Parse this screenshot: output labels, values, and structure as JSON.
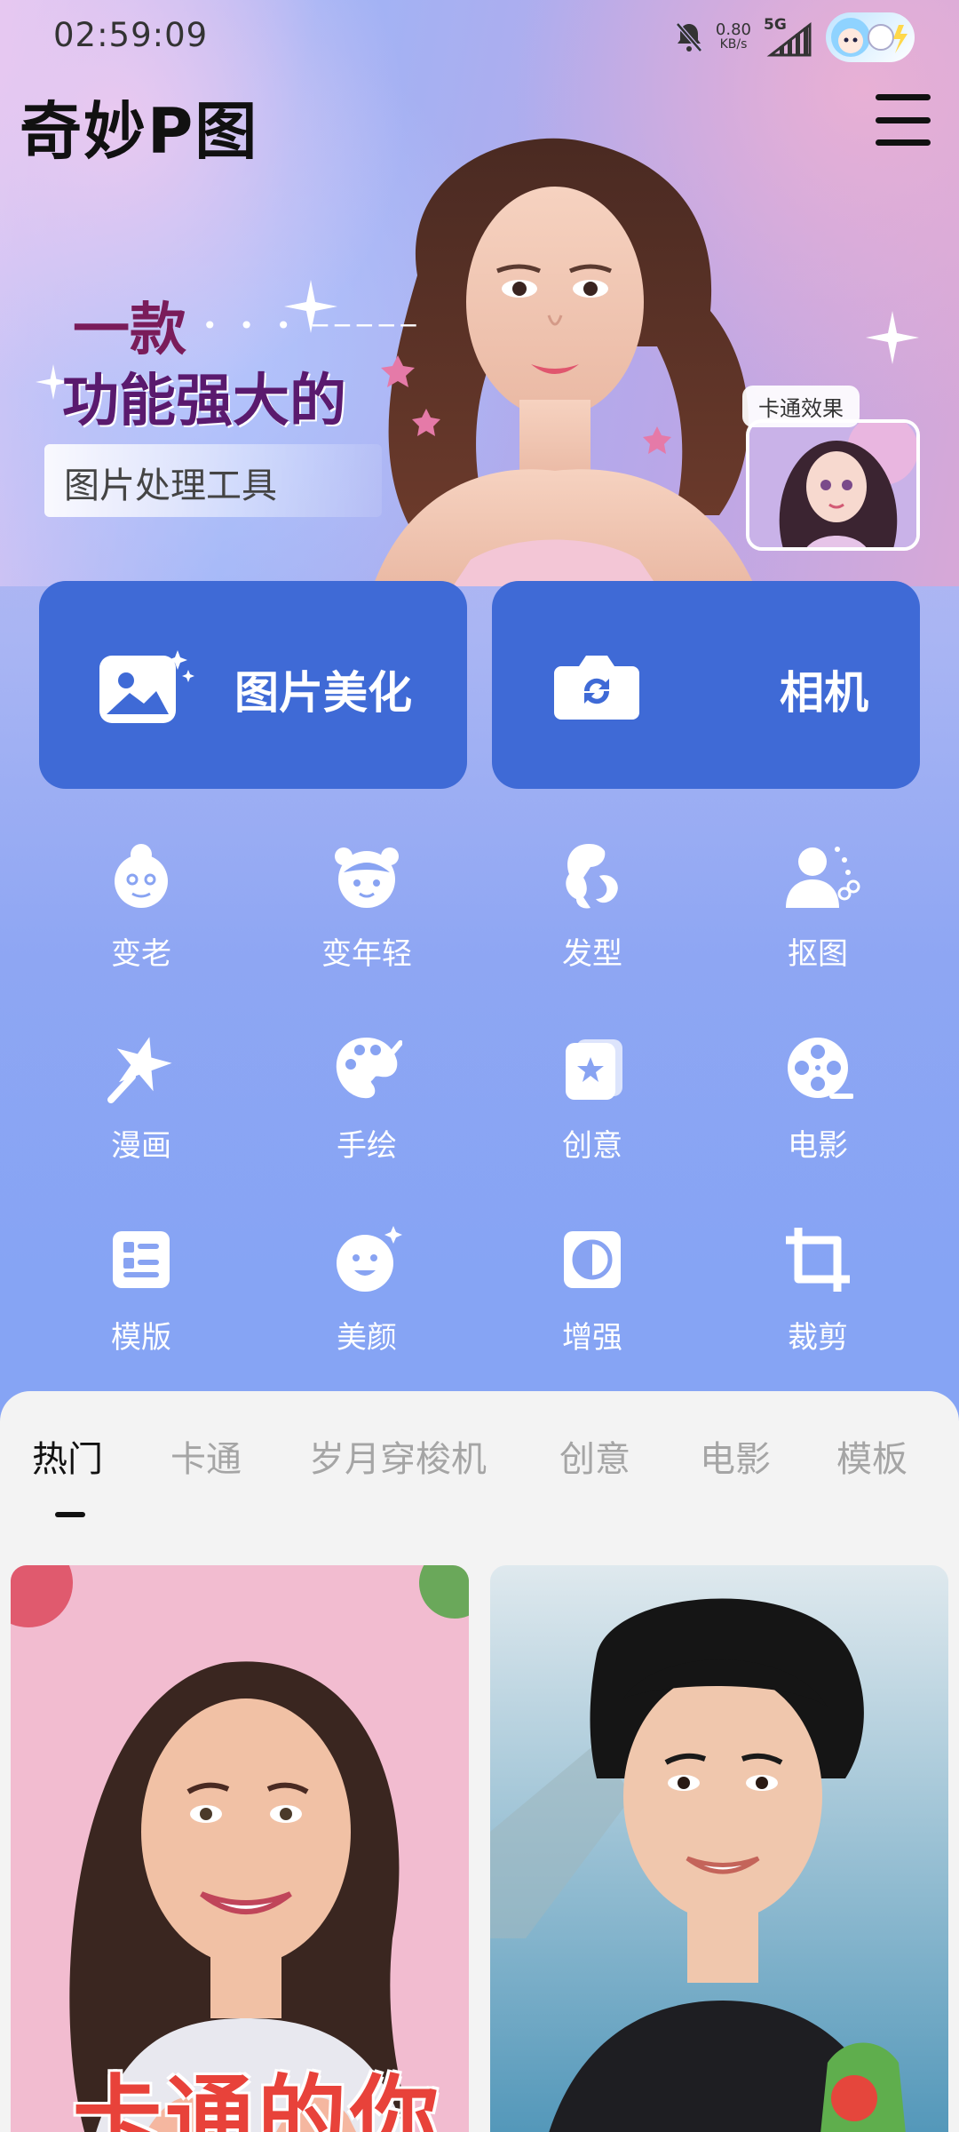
{
  "status_bar": {
    "time": "02:59:09",
    "net_speed_value": "0.80",
    "net_speed_unit": "KB/s",
    "network_type": "5G"
  },
  "header": {
    "app_title": "奇妙P图",
    "menu_icon": "hamburger-menu-icon"
  },
  "hero": {
    "tagline_line1": "一款",
    "tagline_line2": "功能强大的",
    "tagline_line3": "图片处理工具",
    "cartoon_badge": "卡通效果"
  },
  "primary_actions": [
    {
      "label": "图片美化",
      "icon": "image-beautify-icon"
    },
    {
      "label": "相机",
      "icon": "camera-icon"
    }
  ],
  "tools": [
    {
      "label": "变老",
      "icon": "old-face-icon"
    },
    {
      "label": "变年轻",
      "icon": "young-face-icon"
    },
    {
      "label": "发型",
      "icon": "hairstyle-icon"
    },
    {
      "label": "抠图",
      "icon": "cutout-icon"
    },
    {
      "label": "漫画",
      "icon": "comic-wand-icon"
    },
    {
      "label": "手绘",
      "icon": "palette-icon"
    },
    {
      "label": "创意",
      "icon": "creative-star-icon"
    },
    {
      "label": "电影",
      "icon": "film-reel-icon"
    },
    {
      "label": "模版",
      "icon": "template-icon"
    },
    {
      "label": "美颜",
      "icon": "beauty-face-icon"
    },
    {
      "label": "增强",
      "icon": "enhance-contrast-icon"
    },
    {
      "label": "裁剪",
      "icon": "crop-icon"
    }
  ],
  "feed": {
    "tabs": [
      "热门",
      "卡通",
      "岁月穿梭机",
      "创意",
      "电影",
      "模板"
    ],
    "active_tab": "热门",
    "cards": [
      {
        "caption": "卡通的你"
      },
      {
        "caption": ""
      }
    ]
  },
  "colors": {
    "primary_button": "#3f6ad6",
    "caption_red": "#e8423a"
  }
}
